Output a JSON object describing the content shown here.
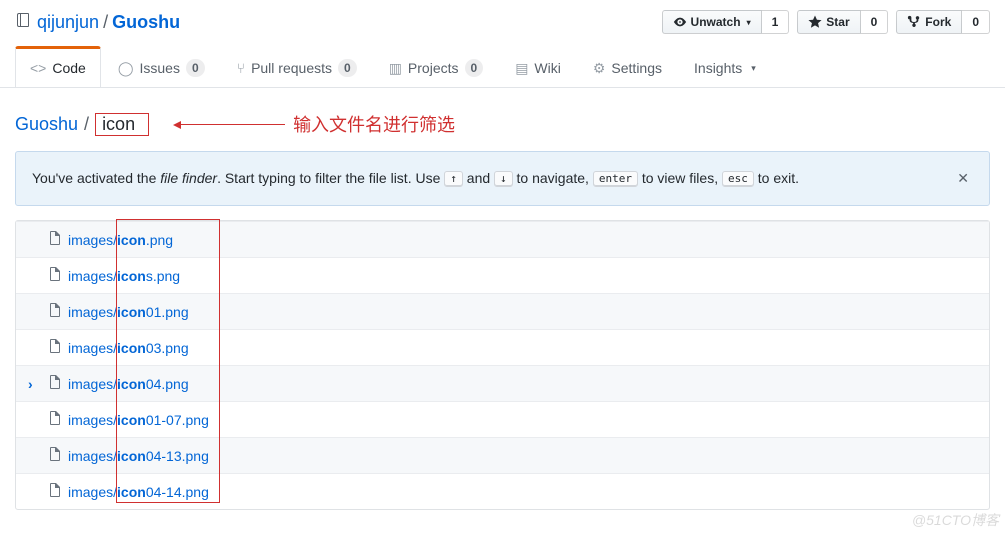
{
  "repo": {
    "owner": "qijunjun",
    "name": "Guoshu"
  },
  "actions": {
    "watch": {
      "label": "Unwatch",
      "count": "1"
    },
    "star": {
      "label": "Star",
      "count": "0"
    },
    "fork": {
      "label": "Fork",
      "count": "0"
    }
  },
  "tabs": {
    "code": "Code",
    "issues": {
      "label": "Issues",
      "count": "0"
    },
    "prs": {
      "label": "Pull requests",
      "count": "0"
    },
    "projects": {
      "label": "Projects",
      "count": "0"
    },
    "wiki": "Wiki",
    "settings": "Settings",
    "insights": "Insights"
  },
  "breadcrumb": {
    "root": "Guoshu",
    "query": "icon"
  },
  "annotation": "输入文件名进行筛选",
  "notice": {
    "p1": "You've activated the ",
    "em": "file finder",
    "p2": ". Start typing to filter the file list. Use ",
    "k1": "↑",
    "p3": " and ",
    "k2": "↓",
    "p4": " to navigate, ",
    "k3": "enter",
    "p5": " to view files, ",
    "k4": "esc",
    "p6": " to exit."
  },
  "files": [
    {
      "prefix": "images/",
      "match": "icon",
      "suffix": ".png",
      "active": false
    },
    {
      "prefix": "images/",
      "match": "icon",
      "suffix": "s.png",
      "active": false
    },
    {
      "prefix": "images/",
      "match": "icon",
      "suffix": "01.png",
      "active": false
    },
    {
      "prefix": "images/",
      "match": "icon",
      "suffix": "03.png",
      "active": false
    },
    {
      "prefix": "images/",
      "match": "icon",
      "suffix": "04.png",
      "active": true
    },
    {
      "prefix": "images/",
      "match": "icon",
      "suffix": "01-07.png",
      "active": false
    },
    {
      "prefix": "images/",
      "match": "icon",
      "suffix": "04-13.png",
      "active": false
    },
    {
      "prefix": "images/",
      "match": "icon",
      "suffix": "04-14.png",
      "active": false
    }
  ],
  "watermark": "@51CTO博客"
}
